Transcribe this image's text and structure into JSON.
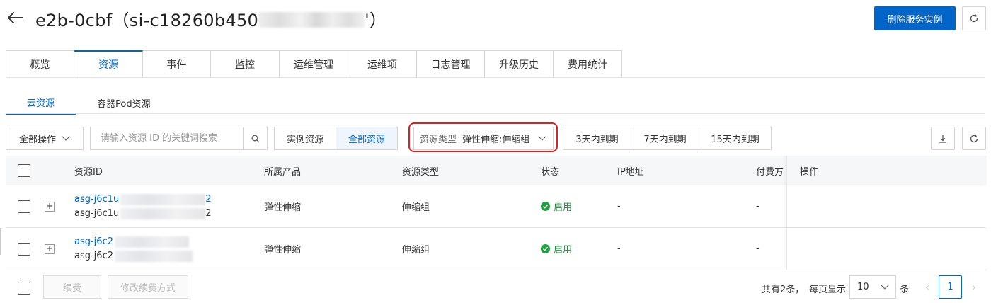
{
  "header": {
    "title_prefix": "e2b-0cbf（si-c18260b450",
    "title_suffix": "'）",
    "primary_action": "删除服务实例"
  },
  "main_tabs": [
    "概览",
    "资源",
    "事件",
    "监控",
    "运维管理",
    "运维项",
    "日志管理",
    "升级历史",
    "费用统计"
  ],
  "main_tab_active": "资源",
  "sub_tabs": [
    "云资源",
    "容器Pod资源"
  ],
  "sub_tab_active": "云资源",
  "toolbar": {
    "bulk_action": "全部操作",
    "search_placeholder": "请输入资源 ID 的关键词搜索",
    "scope_buttons": [
      "实例资源",
      "全部资源"
    ],
    "scope_active": "全部资源",
    "filter_label": "资源类型",
    "filter_value": "弹性伸缩:伸缩组",
    "expiry_buttons": [
      "3天内到期",
      "7天内到期",
      "15天内到期"
    ]
  },
  "table": {
    "columns": [
      "资源ID",
      "所属产品",
      "资源类型",
      "状态",
      "IP地址",
      "付費方式",
      "操作"
    ],
    "rows": [
      {
        "id_link": "asg-j6c1u",
        "id_link_end": "2",
        "id_text": "asg-j6c1u",
        "id_text_end": "2",
        "product": "弹性伸缩",
        "type": "伸缩组",
        "status": "启用",
        "ip": "-",
        "billing": "-"
      },
      {
        "id_link": "asg-j6c2",
        "id_link_end": "",
        "id_text": "asg-j6c2",
        "id_text_end": "",
        "product": "弹性伸缩",
        "type": "伸缩组",
        "status": "启用",
        "ip": "-",
        "billing": "-"
      }
    ]
  },
  "footer": {
    "renew": "续费",
    "change_renew": "修改续费方式",
    "total": "共有2条，",
    "per_page_label": "每页显示",
    "per_page_value": "10",
    "per_page_unit": "条",
    "current_page": "1"
  },
  "colors": {
    "primary": "#0064c8",
    "status_green": "#23a044",
    "highlight_red": "#e02020"
  }
}
